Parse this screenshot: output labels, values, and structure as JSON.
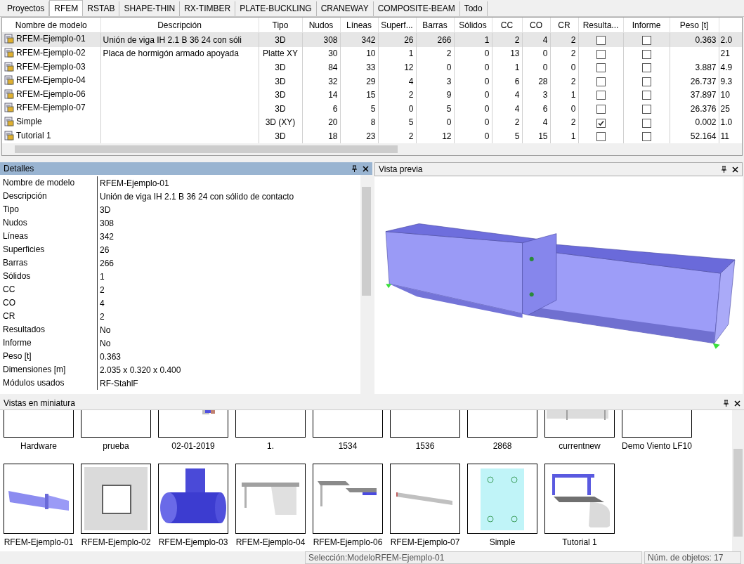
{
  "tabs": [
    {
      "label": "Proyectos",
      "selected": false
    },
    {
      "label": "RFEM",
      "selected": true
    },
    {
      "label": "RSTAB",
      "selected": false
    },
    {
      "label": "SHAPE-THIN",
      "selected": false
    },
    {
      "label": "RX-TIMBER",
      "selected": false
    },
    {
      "label": "PLATE-BUCKLING",
      "selected": false
    },
    {
      "label": "CRANEWAY",
      "selected": false
    },
    {
      "label": "COMPOSITE-BEAM",
      "selected": false
    },
    {
      "label": "Todo",
      "selected": false
    }
  ],
  "table": {
    "columns": [
      "Nombre de modelo",
      "Descripción",
      "Tipo",
      "Nudos",
      "Líneas",
      "Superf...",
      "Barras",
      "Sólidos",
      "CC",
      "CO",
      "CR",
      "Resulta...",
      "Informe",
      "Peso [t]"
    ],
    "rows": [
      {
        "name": "RFEM-Ejemplo-01",
        "description": "Unión de viga IH 2.1 B 36 24 con sóli",
        "type": "3D",
        "nodes": "308",
        "lines": "342",
        "surfaces": "26",
        "members": "266",
        "solids": "1",
        "cc": "2",
        "co": "4",
        "cr": "2",
        "results": false,
        "report": false,
        "weight": "0.363",
        "column_15": "2.0",
        "selected": true
      },
      {
        "name": "RFEM-Ejemplo-02",
        "description": "Placa de hormigón armado apoyada",
        "type": "Platte XY",
        "nodes": "30",
        "lines": "10",
        "surfaces": "1",
        "members": "2",
        "solids": "0",
        "cc": "13",
        "co": "0",
        "cr": "2",
        "results": false,
        "report": false,
        "column_15": "21",
        "selected": false
      },
      {
        "name": "RFEM-Ejemplo-03",
        "type": "3D",
        "nodes": "84",
        "lines": "33",
        "surfaces": "12",
        "members": "0",
        "solids": "0",
        "cc": "1",
        "co": "0",
        "cr": "0",
        "results": false,
        "report": false,
        "weight": "3.887",
        "column_15": "4.9",
        "selected": false
      },
      {
        "name": "RFEM-Ejemplo-04",
        "type": "3D",
        "nodes": "32",
        "lines": "29",
        "surfaces": "4",
        "members": "3",
        "solids": "0",
        "cc": "6",
        "co": "28",
        "cr": "2",
        "results": false,
        "report": false,
        "weight": "26.737",
        "column_15": "9.3",
        "selected": false
      },
      {
        "name": "RFEM-Ejemplo-06",
        "type": "3D",
        "nodes": "14",
        "lines": "15",
        "surfaces": "2",
        "members": "9",
        "solids": "0",
        "cc": "4",
        "co": "3",
        "cr": "1",
        "results": false,
        "report": false,
        "weight": "37.897",
        "column_15": "10",
        "selected": false
      },
      {
        "name": "RFEM-Ejemplo-07",
        "type": "3D",
        "nodes": "6",
        "lines": "5",
        "surfaces": "0",
        "members": "5",
        "solids": "0",
        "cc": "4",
        "co": "6",
        "cr": "0",
        "results": false,
        "report": false,
        "weight": "26.376",
        "column_15": "25",
        "selected": false
      },
      {
        "name": "Simple",
        "type": "3D (XY)",
        "nodes": "20",
        "lines": "8",
        "surfaces": "5",
        "members": "0",
        "solids": "0",
        "cc": "2",
        "co": "4",
        "cr": "2",
        "results": true,
        "report": false,
        "weight": "0.002",
        "column_15": "1.0",
        "selected": false
      },
      {
        "name": "Tutorial 1",
        "type": "3D",
        "nodes": "18",
        "lines": "23",
        "surfaces": "2",
        "members": "12",
        "solids": "0",
        "cc": "5",
        "co": "15",
        "cr": "1",
        "results": false,
        "report": false,
        "weight": "52.164",
        "column_15": "11",
        "selected": false
      }
    ]
  },
  "details": {
    "title": "Detalles",
    "rows": [
      {
        "label": "Nombre de modelo",
        "value": "RFEM-Ejemplo-01"
      },
      {
        "label": "Descripción",
        "value": "Unión de viga IH 2.1 B 36 24 con sólido de contacto"
      },
      {
        "label": "Tipo",
        "value": "3D"
      },
      {
        "label": "Nudos",
        "value": "308"
      },
      {
        "label": "Líneas",
        "value": "342"
      },
      {
        "label": "Superficies",
        "value": "26"
      },
      {
        "label": "Barras",
        "value": "266"
      },
      {
        "label": "Sólidos",
        "value": "1"
      },
      {
        "label": "CC",
        "value": "2"
      },
      {
        "label": "CO",
        "value": "4"
      },
      {
        "label": "CR",
        "value": "2"
      },
      {
        "label": "Resultados",
        "value": "No"
      },
      {
        "label": "Informe",
        "value": "No"
      },
      {
        "label": "Peso [t]",
        "value": "0.363"
      },
      {
        "label": "Dimensiones [m]",
        "value": "2.035 x 0.320 x 0.400"
      },
      {
        "label": "Módulos usados",
        "value": "RF-StahlF"
      }
    ]
  },
  "preview": {
    "title": "Vista previa"
  },
  "thumbnails": {
    "title": "Vistas en miniatura",
    "rows": [
      [
        "Hardware",
        "prueba",
        "02-01-2019",
        "1.",
        "1534",
        "1536",
        "2868",
        "currentnew",
        "Demo Viento LF10"
      ],
      [
        "RFEM-Ejemplo-01",
        "RFEM-Ejemplo-02",
        "RFEM-Ejemplo-03",
        "RFEM-Ejemplo-04",
        "RFEM-Ejemplo-06",
        "RFEM-Ejemplo-07",
        "Simple",
        "Tutorial 1"
      ]
    ]
  },
  "status_bar": {
    "selection": "Selección:ModeloRFEM-Ejemplo-01",
    "count": "Núm. de objetos: 17"
  }
}
